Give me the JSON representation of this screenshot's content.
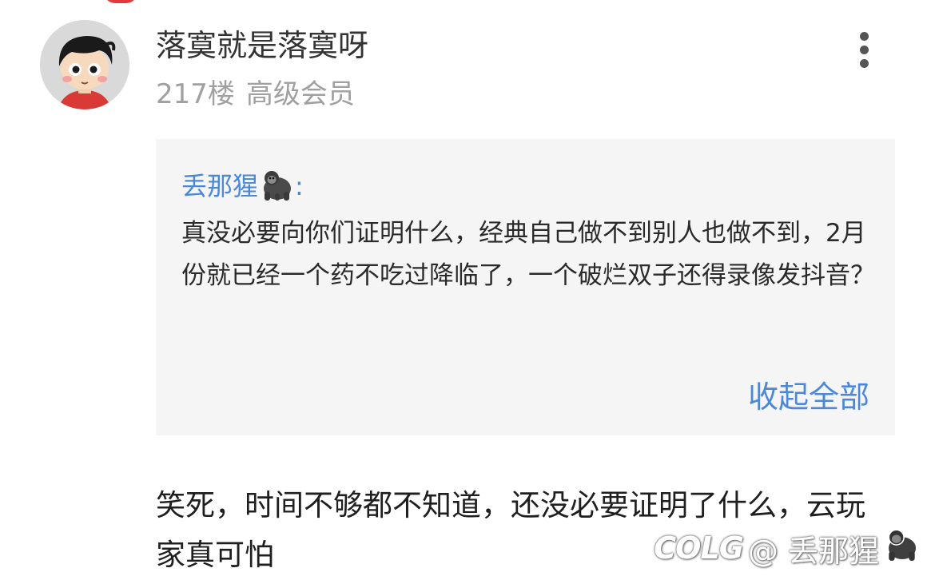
{
  "post": {
    "username": "落寞就是落寞呀",
    "floor": "217楼",
    "member_level": "高级会员",
    "more_icon": "more-vertical-icon"
  },
  "quote": {
    "author": "丢那猩",
    "author_emoji": "gorilla-emoji",
    "separator": ":",
    "text": "真没必要向你们证明什么，经典自己做不到别人也做不到，2月份就已经一个药不吃过降临了，一个破烂双子还得录像发抖音？",
    "collapse_label": "收起全部"
  },
  "reply": {
    "text": "笑死，时间不够都不知道，还没必要证明了什么，云玩家真可怕"
  },
  "watermark": {
    "logo": "COLG",
    "handle": "@ 丢那猩",
    "emoji": "gorilla-emoji"
  },
  "colors": {
    "link": "#4b88d8",
    "meta": "#a0a0a0",
    "quote_bg": "#f5f5f5"
  }
}
